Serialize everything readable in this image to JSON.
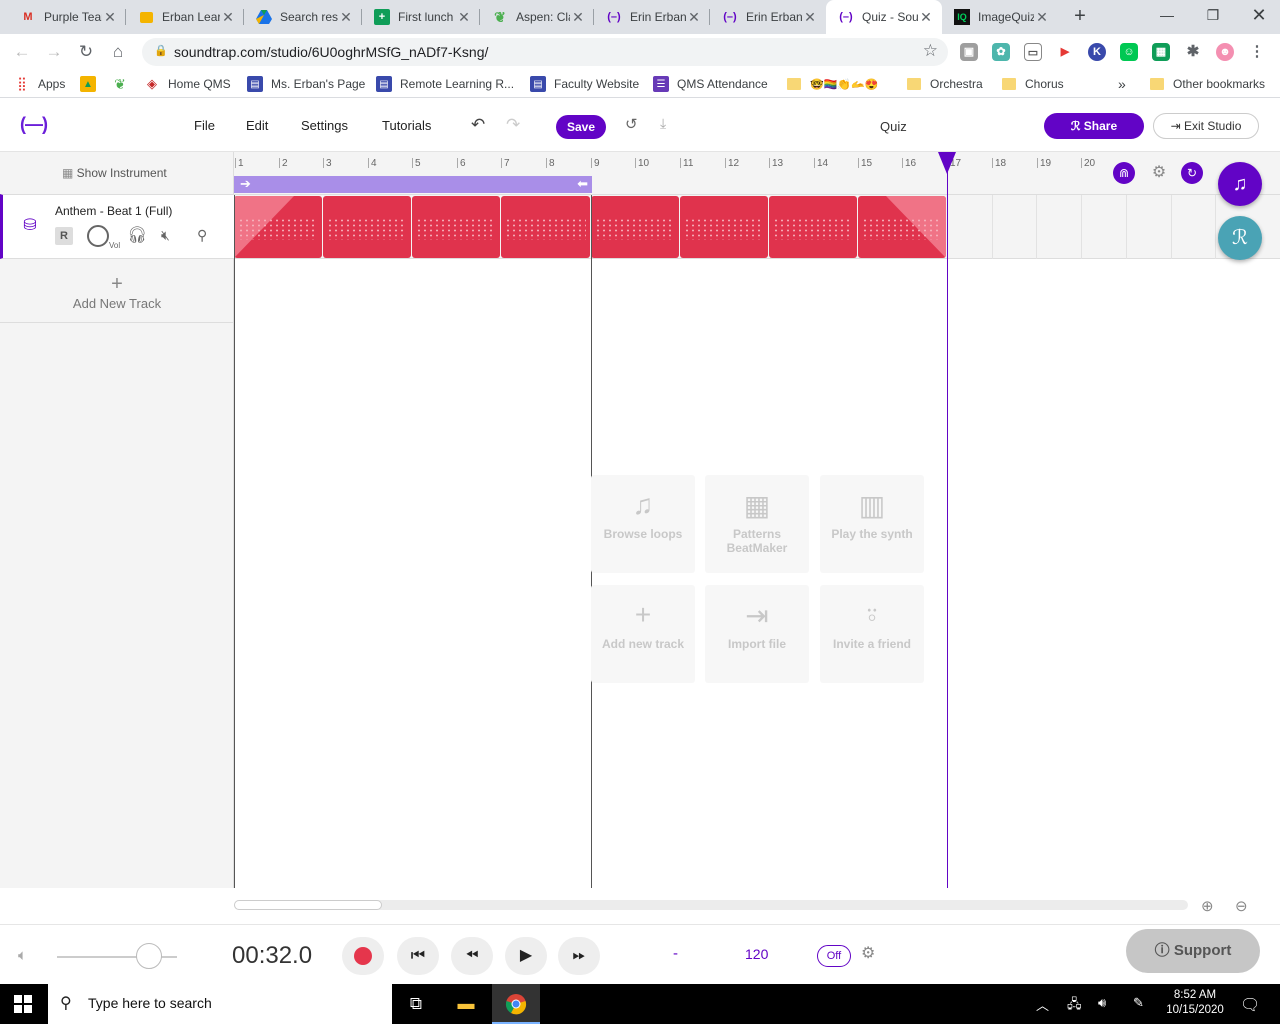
{
  "browser": {
    "tabs": [
      {
        "title": "Purple Team",
        "favicon": "gmail-icon",
        "color": "#d93025"
      },
      {
        "title": "Erban Learning",
        "favicon": "slides-icon",
        "color": "#f4b400"
      },
      {
        "title": "Search results",
        "favicon": "drive-icon",
        "color": "#1a73e8"
      },
      {
        "title": "First lunch",
        "favicon": "sheets-icon",
        "color": "#0f9d58"
      },
      {
        "title": "Aspen: Class",
        "favicon": "aspen-icon",
        "color": "#4caf50"
      },
      {
        "title": "Erin Erban",
        "favicon": "soundtrap-icon",
        "color": "#6204c6"
      },
      {
        "title": "Erin Erban",
        "favicon": "soundtrap-icon",
        "color": "#6204c6"
      },
      {
        "title": "Quiz - Soundtrap",
        "favicon": "soundtrap-icon",
        "color": "#6204c6",
        "active": true
      },
      {
        "title": "ImageQuiz",
        "favicon": "iq-icon",
        "color": "#00a651"
      }
    ],
    "url": "soundtrap.com/studio/6U0oghrMSfG_nADf7-Ksng/",
    "bookmarks": [
      {
        "label": "Apps",
        "icon": "apps-grid-icon"
      },
      {
        "label": "",
        "icon": "classroom-icon"
      },
      {
        "label": "",
        "icon": "aspen-leaf-icon"
      },
      {
        "label": "Home QMS",
        "icon": "web-icon"
      },
      {
        "label": "Ms. Erban's Page",
        "icon": "site-icon"
      },
      {
        "label": "Remote Learning R...",
        "icon": "site-icon"
      },
      {
        "label": "Faculty Website",
        "icon": "site-icon"
      },
      {
        "label": "QMS Attendance",
        "icon": "forms-icon"
      },
      {
        "label": "🤓🏳️‍🌈👏🫴😍",
        "icon": "folder-icon"
      },
      {
        "label": "Orchestra",
        "icon": "folder-icon"
      },
      {
        "label": "Chorus",
        "icon": "folder-icon"
      }
    ],
    "more_bookmarks": "»",
    "other_bookmarks": "Other bookmarks"
  },
  "studio": {
    "menu": [
      "File",
      "Edit",
      "Settings",
      "Tutorials"
    ],
    "save_label": "Save",
    "project_title": "Quiz",
    "share_label": "Share",
    "exit_label": "Exit Studio",
    "show_instrument": "Show Instrument",
    "track": {
      "name": "Anthem - Beat 1 (Full)",
      "record_label": "R",
      "volume_label": "Vol"
    },
    "add_track_label": "Add New Track",
    "ruler_ticks": [
      "1",
      "2",
      "3",
      "4",
      "5",
      "6",
      "7",
      "8",
      "9",
      "10",
      "11",
      "12",
      "13",
      "14",
      "15",
      "16",
      "17",
      "18",
      "19",
      "20"
    ],
    "empty_state": [
      {
        "label": "Browse loops",
        "icon": "music-note-icon"
      },
      {
        "label": "Patterns BeatMaker",
        "icon": "pattern-grid-icon"
      },
      {
        "label": "Play the synth",
        "icon": "piano-icon"
      },
      {
        "label": "Add new track",
        "icon": "plus-icon"
      },
      {
        "label": "Import file",
        "icon": "import-icon"
      },
      {
        "label": "Invite a friend",
        "icon": "invite-user-icon"
      }
    ],
    "transport": {
      "time": "00:32.0",
      "key": "-",
      "tempo": "120",
      "metronome": "Off"
    },
    "support_label": "Support",
    "accent_color": "#6204c6",
    "clip_color": "#e0334d"
  },
  "taskbar": {
    "search_placeholder": "Type here to search",
    "time": "8:52 AM",
    "date": "10/15/2020"
  }
}
